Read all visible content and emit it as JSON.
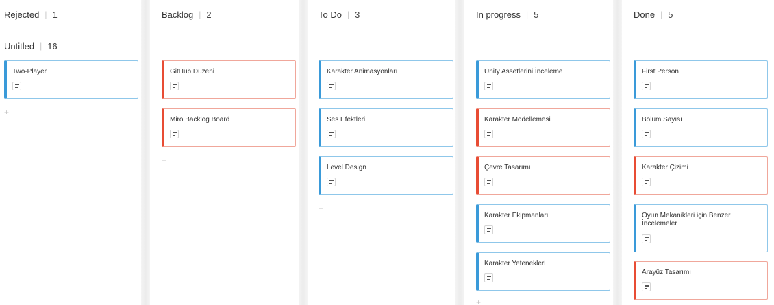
{
  "columns": [
    {
      "name": "Rejected",
      "count": "1",
      "line_color": "#cfcfcf",
      "group": {
        "name": "Untitled",
        "count": "16"
      },
      "cards": [
        {
          "title": "Two-Player",
          "color": "blue"
        }
      ],
      "add_label": "+"
    },
    {
      "name": "Backlog",
      "count": "2",
      "line_color": "#e84c34",
      "cards": [
        {
          "title": "GitHub Düzeni",
          "color": "red"
        },
        {
          "title": "Miro Backlog Board",
          "color": "red"
        }
      ],
      "add_label": "+"
    },
    {
      "name": "To Do",
      "count": "3",
      "line_color": "#cfcfcf",
      "cards": [
        {
          "title": "Karakter Animasyonları",
          "color": "blue"
        },
        {
          "title": "Ses Efektleri",
          "color": "blue"
        },
        {
          "title": "Level Design",
          "color": "blue"
        }
      ],
      "add_label": "+"
    },
    {
      "name": "In progress",
      "count": "5",
      "line_color": "#f2c511",
      "cards": [
        {
          "title": "Unity Assetlerini İnceleme",
          "color": "blue"
        },
        {
          "title": "Karakter Modellemesi",
          "color": "red"
        },
        {
          "title": "Çevre Tasarımı",
          "color": "red"
        },
        {
          "title": "Karakter Ekipmanları",
          "color": "blue"
        },
        {
          "title": "Karakter Yetenekleri",
          "color": "blue"
        }
      ],
      "add_label": "+"
    },
    {
      "name": "Done",
      "count": "5",
      "line_color": "#8cc63f",
      "cards": [
        {
          "title": "First Person",
          "color": "blue"
        },
        {
          "title": "Bölüm Sayısı",
          "color": "blue"
        },
        {
          "title": "Karakter Çizimi",
          "color": "red"
        },
        {
          "title": "Oyun Mekanikleri için Benzer İncelemeler",
          "color": "blue"
        },
        {
          "title": "Arayüz Tasarımı",
          "color": "red"
        }
      ]
    }
  ]
}
